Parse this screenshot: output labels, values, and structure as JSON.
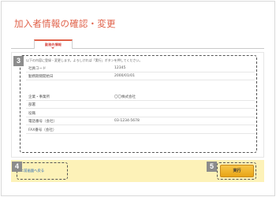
{
  "header": {
    "title": "加入者情報の確認・変更"
  },
  "tabs": [
    {
      "label": "勤務先情報"
    }
  ],
  "info": {
    "intro": "以下の内容に登録・変更します。よろしければ「実行」ボタンを押してください。",
    "rows_a": [
      {
        "key": "社員コード",
        "value": "12345"
      },
      {
        "key": "勤務期間開始日",
        "value": "2000/01/01"
      }
    ],
    "rows_b": [
      {
        "key": "企業・事業所",
        "value": "〇〇株式会社"
      },
      {
        "key": "部署",
        "value": ""
      },
      {
        "key": "役職",
        "value": ""
      },
      {
        "key": "電話番号（会社）",
        "value": "03-1234-5678"
      },
      {
        "key": "FAX番号（会社）",
        "value": ""
      }
    ]
  },
  "actions": {
    "back_label": "＜前画面へ戻る",
    "submit_label": "実行"
  },
  "callouts": {
    "c3": "3",
    "c4": "4",
    "c5": "5"
  },
  "colors": {
    "accent": "#e0624a",
    "bar": "#fdf2b8",
    "button": "#f0b42c",
    "badge": "#8c8c8c"
  }
}
